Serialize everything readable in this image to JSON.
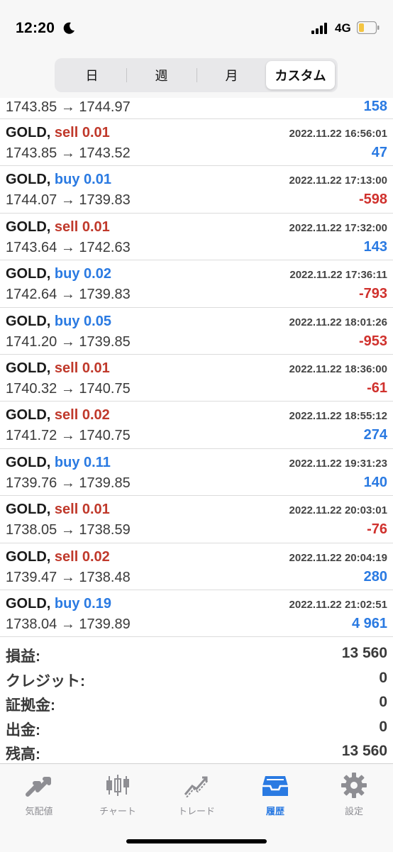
{
  "status": {
    "time": "12:20",
    "network": "4G"
  },
  "segments": [
    {
      "label": "日"
    },
    {
      "label": "週"
    },
    {
      "label": "月"
    },
    {
      "label": "カスタム"
    }
  ],
  "partial_row": {
    "prices": "1743.85 → 1744.97",
    "profit": "158"
  },
  "trades": [
    {
      "symbol": "GOLD,",
      "side": "sell 0.01",
      "time": "2022.11.22 16:56:01",
      "prices": "1743.85 → 1743.52",
      "profit": "47"
    },
    {
      "symbol": "GOLD,",
      "side": "buy 0.01",
      "time": "2022.11.22 17:13:00",
      "prices": "1744.07 → 1739.83",
      "profit": "-598"
    },
    {
      "symbol": "GOLD,",
      "side": "sell 0.01",
      "time": "2022.11.22 17:32:00",
      "prices": "1743.64 → 1742.63",
      "profit": "143"
    },
    {
      "symbol": "GOLD,",
      "side": "buy 0.02",
      "time": "2022.11.22 17:36:11",
      "prices": "1742.64 → 1739.83",
      "profit": "-793"
    },
    {
      "symbol": "GOLD,",
      "side": "buy 0.05",
      "time": "2022.11.22 18:01:26",
      "prices": "1741.20 → 1739.85",
      "profit": "-953"
    },
    {
      "symbol": "GOLD,",
      "side": "sell 0.01",
      "time": "2022.11.22 18:36:00",
      "prices": "1740.32 → 1740.75",
      "profit": "-61"
    },
    {
      "symbol": "GOLD,",
      "side": "sell 0.02",
      "time": "2022.11.22 18:55:12",
      "prices": "1741.72 → 1740.75",
      "profit": "274"
    },
    {
      "symbol": "GOLD,",
      "side": "buy 0.11",
      "time": "2022.11.22 19:31:23",
      "prices": "1739.76 → 1739.85",
      "profit": "140"
    },
    {
      "symbol": "GOLD,",
      "side": "sell 0.01",
      "time": "2022.11.22 20:03:01",
      "prices": "1738.05 → 1738.59",
      "profit": "-76"
    },
    {
      "symbol": "GOLD,",
      "side": "sell 0.02",
      "time": "2022.11.22 20:04:19",
      "prices": "1739.47 → 1738.48",
      "profit": "280"
    },
    {
      "symbol": "GOLD,",
      "side": "buy 0.19",
      "time": "2022.11.22 21:02:51",
      "prices": "1738.04 → 1739.89",
      "profit": "4 961"
    }
  ],
  "summary": [
    {
      "label": "損益:",
      "value": "13 560"
    },
    {
      "label": "クレジット:",
      "value": "0"
    },
    {
      "label": "証拠金:",
      "value": "0"
    },
    {
      "label": "出金:",
      "value": "0"
    },
    {
      "label": "残高:",
      "value": "13 560"
    }
  ],
  "tabs": [
    {
      "label": "気配値",
      "icon": "quotes-icon"
    },
    {
      "label": "チャート",
      "icon": "candlestick-chart-icon"
    },
    {
      "label": "トレード",
      "icon": "trade-chart-icon"
    },
    {
      "label": "履歴",
      "icon": "history-inbox-icon"
    },
    {
      "label": "設定",
      "icon": "gear-icon"
    }
  ],
  "colors": {
    "sell": "#c0392b",
    "buy": "#2a7ae2",
    "positive": "#2a7ae2",
    "negative": "#d0312d",
    "active_tab": "#2a7ae2"
  }
}
